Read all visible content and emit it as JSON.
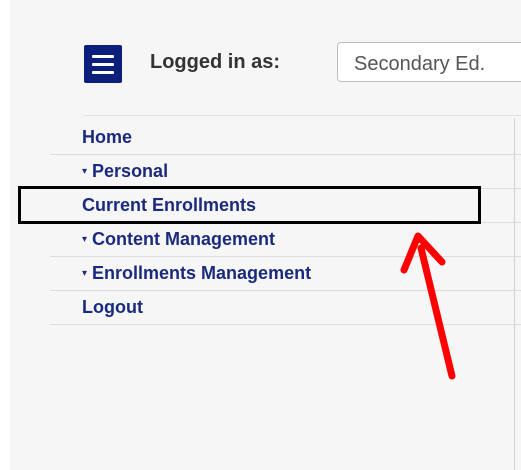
{
  "header": {
    "logged_in_label": "Logged in as:",
    "organization_value": "Secondary Ed."
  },
  "nav": {
    "items": [
      {
        "label": "Home",
        "expandable": false
      },
      {
        "label": "Personal",
        "expandable": true,
        "caret": "▾"
      },
      {
        "label": "Current Enrollments",
        "expandable": false
      },
      {
        "label": "Content Management",
        "expandable": true,
        "caret": "▾"
      },
      {
        "label": "Enrollments Management",
        "expandable": true,
        "caret": "▾"
      },
      {
        "label": "Logout",
        "expandable": false
      }
    ]
  },
  "annotation": {
    "highlighted_item": "Current Enrollments",
    "arrow_color": "#ff0000",
    "box_color": "#000000"
  },
  "colors": {
    "accent": "#0b1f7b",
    "nav_text": "#1a2a7d"
  }
}
